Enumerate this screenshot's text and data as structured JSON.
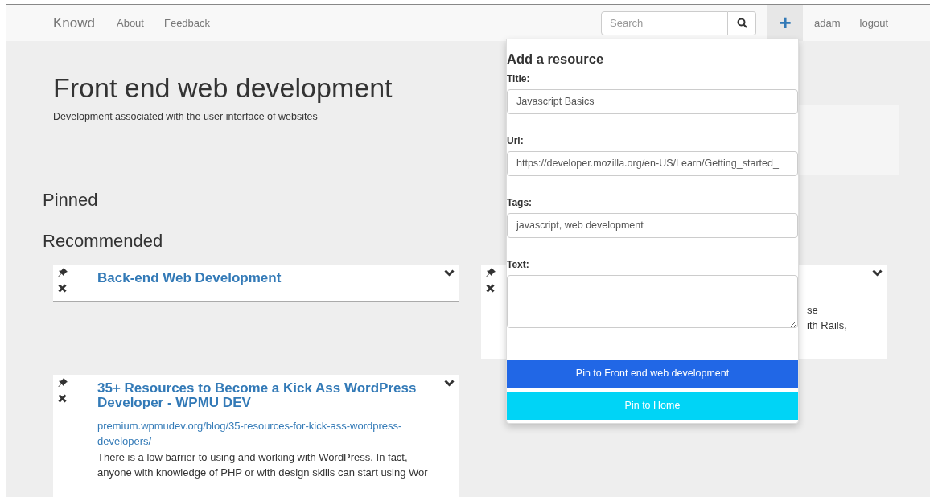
{
  "navbar": {
    "brand": "Knowd",
    "links": [
      "About",
      "Feedback"
    ],
    "search": {
      "placeholder": "Search"
    },
    "add_button": {
      "label": "+",
      "expanded": true
    },
    "user": "adam",
    "logout": "logout"
  },
  "header": {
    "title": "Front end web development",
    "description": "Development associated with the user interface of websites"
  },
  "sections": [
    "Pinned",
    "Recommended"
  ],
  "cards": [
    {
      "title": "Back-end Web Development"
    },
    {
      "fragments": [
        "se",
        "ith Rails,"
      ]
    },
    {
      "title": "35+ Resources to Become a Kick Ass WordPress Developer - WPMU DEV",
      "url": "premium.wpmudev.org/blog/35-resources-for-kick-ass-wordpress-developers/",
      "description": "There is a low barrier to using and working with WordPress. In fact, anyone with knowledge of PHP or with design skills can start using Wor"
    }
  ],
  "add_resource": {
    "title": "Add a resource",
    "fields": [
      {
        "kind": "input",
        "label": "Title:",
        "value": "Javascript Basics"
      },
      {
        "kind": "input",
        "label": "Url:",
        "value": "https://developer.mozilla.org/en-US/Learn/Getting_started_"
      },
      {
        "kind": "input",
        "label": "Tags:",
        "value": "javascript, web development"
      },
      {
        "kind": "textarea",
        "label": "Text:"
      }
    ],
    "buttons": [
      {
        "kind": "primary",
        "label": "Pin to Front end web development"
      },
      {
        "kind": "info",
        "label": "Pin to Home"
      }
    ]
  }
}
